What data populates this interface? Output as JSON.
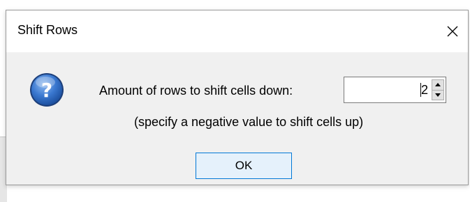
{
  "dialog": {
    "title": "Shift Rows",
    "close_icon": "close-icon",
    "help_icon": "question-help-icon",
    "prompt_label": "Amount of rows to shift cells down:",
    "rows_value": "2",
    "hint": "(specify a negative value to shift cells up)",
    "ok_label": "OK"
  },
  "colors": {
    "dialog_background": "#f0f0f0",
    "titlebar_background": "#ffffff",
    "ok_button_border": "#0078d7",
    "ok_button_background": "#e5f1fb",
    "help_icon_blue": "#2f6cc5"
  }
}
